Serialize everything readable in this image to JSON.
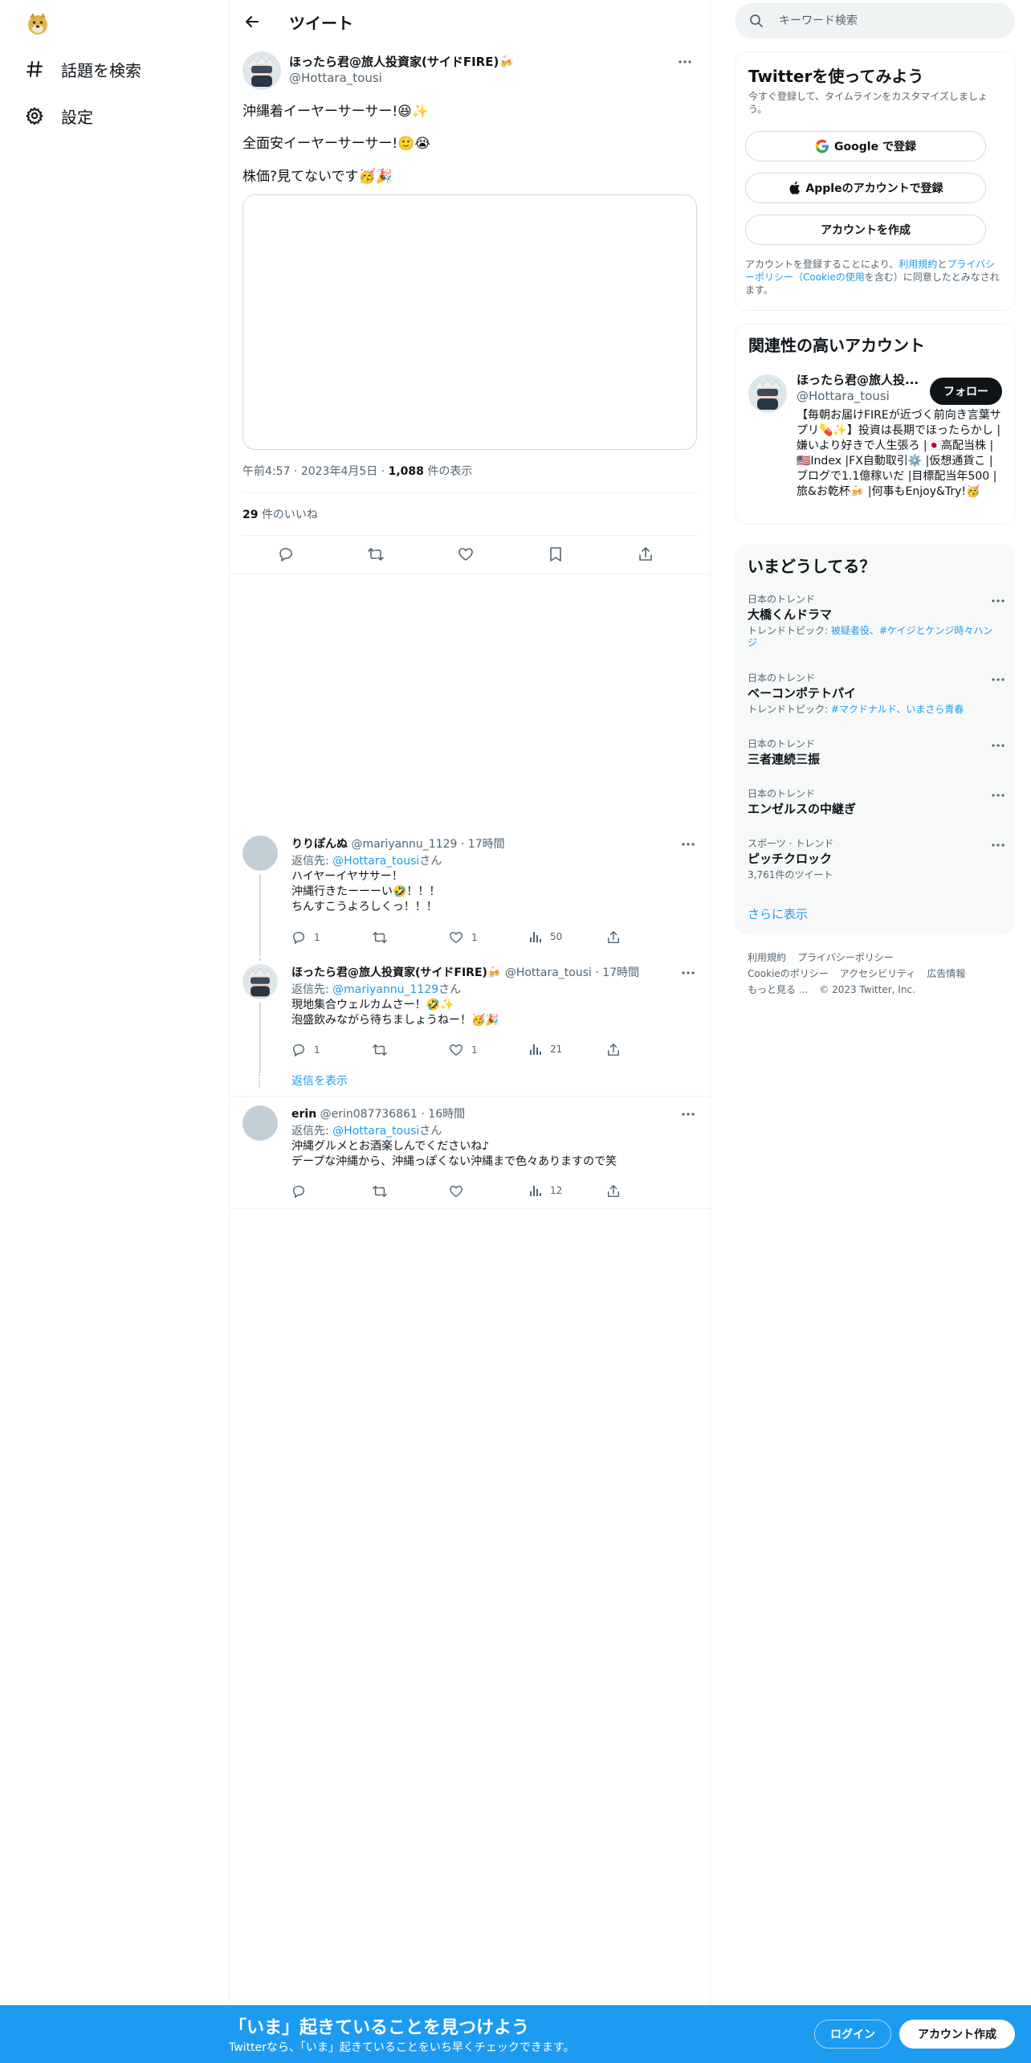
{
  "nav": {
    "logo_icon": "doge-logo-icon",
    "items": [
      {
        "label": "話題を検索",
        "icon": "hashtag-icon"
      },
      {
        "label": "設定",
        "icon": "gear-icon"
      }
    ]
  },
  "header": {
    "title": "ツイート"
  },
  "tweet": {
    "name": "ほったら君@旅人投資家(サイドFIRE)🍻",
    "handle": "@Hottara_tousi",
    "lines": [
      "沖縄着イーヤーサーサー!😆✨",
      "全面安イーヤーサーサー!🙂😭",
      "株価?見てないです🥳🎉"
    ],
    "time": "午前4:57",
    "date": "2023年4月5日",
    "views": "1,088",
    "views_label": "件の表示",
    "likes": "29",
    "likes_label": "件のいいね"
  },
  "replies": [
    {
      "name": "りりぽんぬ",
      "handle": "@mariyannu_1129",
      "time": "17時間",
      "to_prefix": "返信先: ",
      "to_handle": "@Hottara_tousi",
      "to_suffix": "さん",
      "lines": [
        "ハイヤーイヤササー！",
        "沖縄行きたーーーい🤣！！！",
        "ちんすこうよろしくっ！！！"
      ],
      "replies": "1",
      "likes": "1",
      "views": "50"
    },
    {
      "name": "ほったら君@旅人投資家(サイドFIRE)🍻",
      "handle": "@Hottara_tousi",
      "time": "17時間",
      "to_prefix": "返信先: ",
      "to_handle": "@mariyannu_1129",
      "to_suffix": "さん",
      "lines": [
        "現地集合ウェルカムさー！🤣✨",
        "泡盛飲みながら待ちましょうねー！🥳🎉"
      ],
      "replies": "1",
      "likes": "1",
      "views": "21"
    },
    {
      "name": "erin",
      "handle": "@erin087736861",
      "time": "16時間",
      "to_prefix": "返信先: ",
      "to_handle": "@Hottara_tousi",
      "to_suffix": "さん",
      "lines": [
        "沖縄グルメとお酒楽しんでくださいね♪",
        "デープな沖縄から、沖縄っぽくない沖縄まで色々ありますので笑"
      ],
      "replies": "",
      "likes": "",
      "views": "12"
    }
  ],
  "show_replies": "返信を表示",
  "search": {
    "placeholder": "キーワード検索"
  },
  "signup_card": {
    "title": "Twitterを使ってみよう",
    "subtitle": "今すぐ登録して、タイムラインをカスタマイズしましょう。",
    "google": "Google で登録",
    "apple": "Appleのアカウントで登録",
    "create": "アカウントを作成",
    "terms_pre": "アカウントを登録することにより、",
    "terms_link1": "利用規約",
    "terms_mid": "と",
    "terms_link2": "プライバシーポリシー（Cookieの使用",
    "terms_post": "を含む）に同意したとみなされます。"
  },
  "related": {
    "title": "関連性の高いアカウント",
    "name": "ほったら君@旅人投...",
    "handle": "@Hottara_tousi",
    "follow": "フォロー",
    "bio": "【毎朝お届けFIREが近づく前向き言葉サプリ💊✨】投資は長期でほったらかし |嫌いより好きで人生張ろ |🇯🇵高配当株 |🇺🇸Index |FX自動取引⚙️ |仮想通貨こ |ブログで1.1億稼いだ |目標配当年500 |旅&お乾杯🍻 |何事もEnjoy&Try!🥳"
  },
  "trends": {
    "title": "いまどうしてる？",
    "items": [
      {
        "category": "日本のトレンド",
        "title": "大橋くんドラマ",
        "topic_label": "トレンドトピック: ",
        "topics": "被疑者役、#ケイジとケンジ時々ハンジ"
      },
      {
        "category": "日本のトレンド",
        "title": "ベーコンポテトパイ",
        "topic_label": "トレンドトピック: ",
        "topics": "#マクドナルド、いまさら青春"
      },
      {
        "category": "日本のトレンド",
        "title": "三者連続三振",
        "topic_label": "",
        "topics": ""
      },
      {
        "category": "日本のトレンド",
        "title": "エンゼルスの中継ぎ",
        "topic_label": "",
        "topics": ""
      },
      {
        "category": "スポーツ · トレンド",
        "title": "ピッチクロック",
        "topic_label": "3,761件のツイート",
        "topics": ""
      }
    ],
    "show_more": "さらに表示"
  },
  "footer": {
    "links": [
      "利用規約",
      "プライバシーポリシー",
      "Cookieのポリシー",
      "アクセシビリティ",
      "広告情報",
      "もっと見る ..."
    ],
    "copyright": "© 2023 Twitter, Inc."
  },
  "bottom_bar": {
    "title": "「いま」起きていることを見つけよう",
    "subtitle": "Twitterなら、「いま」起きていることをいち早くチェックできます。",
    "login": "ログイン",
    "signup": "アカウント作成"
  },
  "colors": {
    "accent": "#1d9bf0",
    "text": "#0f1419",
    "muted": "#536471"
  }
}
